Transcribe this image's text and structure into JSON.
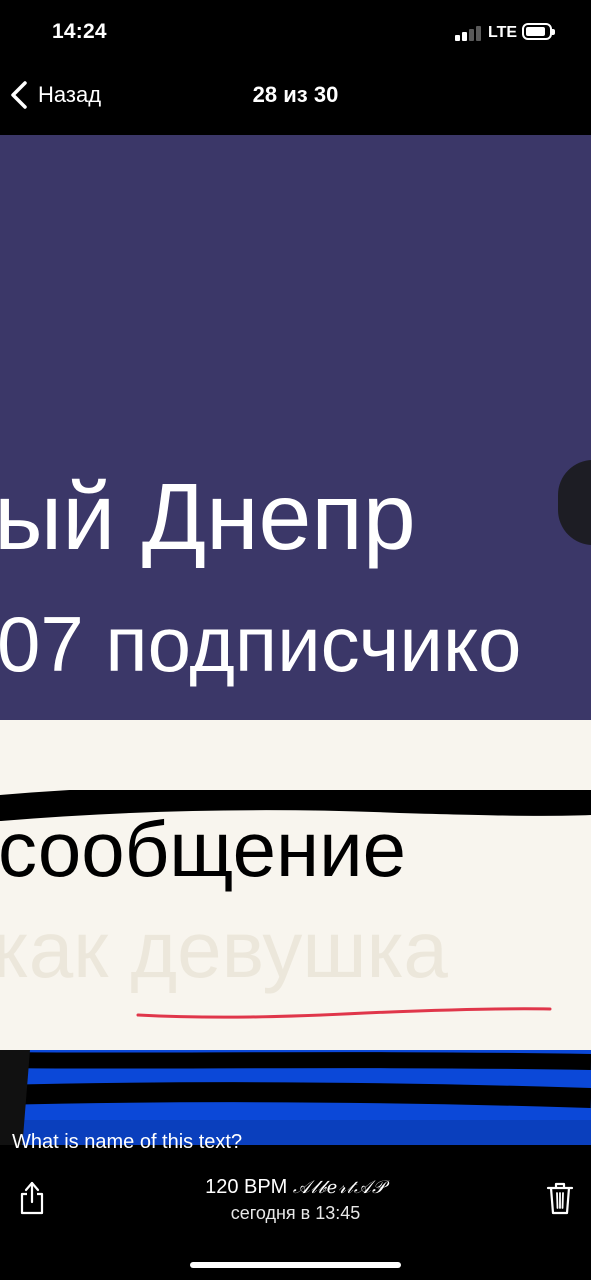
{
  "status_bar": {
    "time": "14:24",
    "network": "LTE"
  },
  "nav": {
    "back_label": "Назад",
    "title": "28 из 30"
  },
  "photo": {
    "channel_name": "ый Днепр",
    "subscribers": "07 подписчико",
    "message_word": "сообщение",
    "faded_text": "как девушка"
  },
  "caption": "What is name of this text?",
  "footer": {
    "line1_prefix": "120 BPM",
    "author": "𝒜𝓁𝒷𝑒𝓇𝓉𝒜𝒫",
    "line2": "сегодня в 13:45"
  },
  "colors": {
    "photo_header_bg": "#3b3768",
    "underline": "#e0364a",
    "band_blue": "#0b48d8"
  },
  "icons": {
    "back": "chevron-left-icon",
    "share": "share-icon",
    "delete": "trash-icon"
  }
}
